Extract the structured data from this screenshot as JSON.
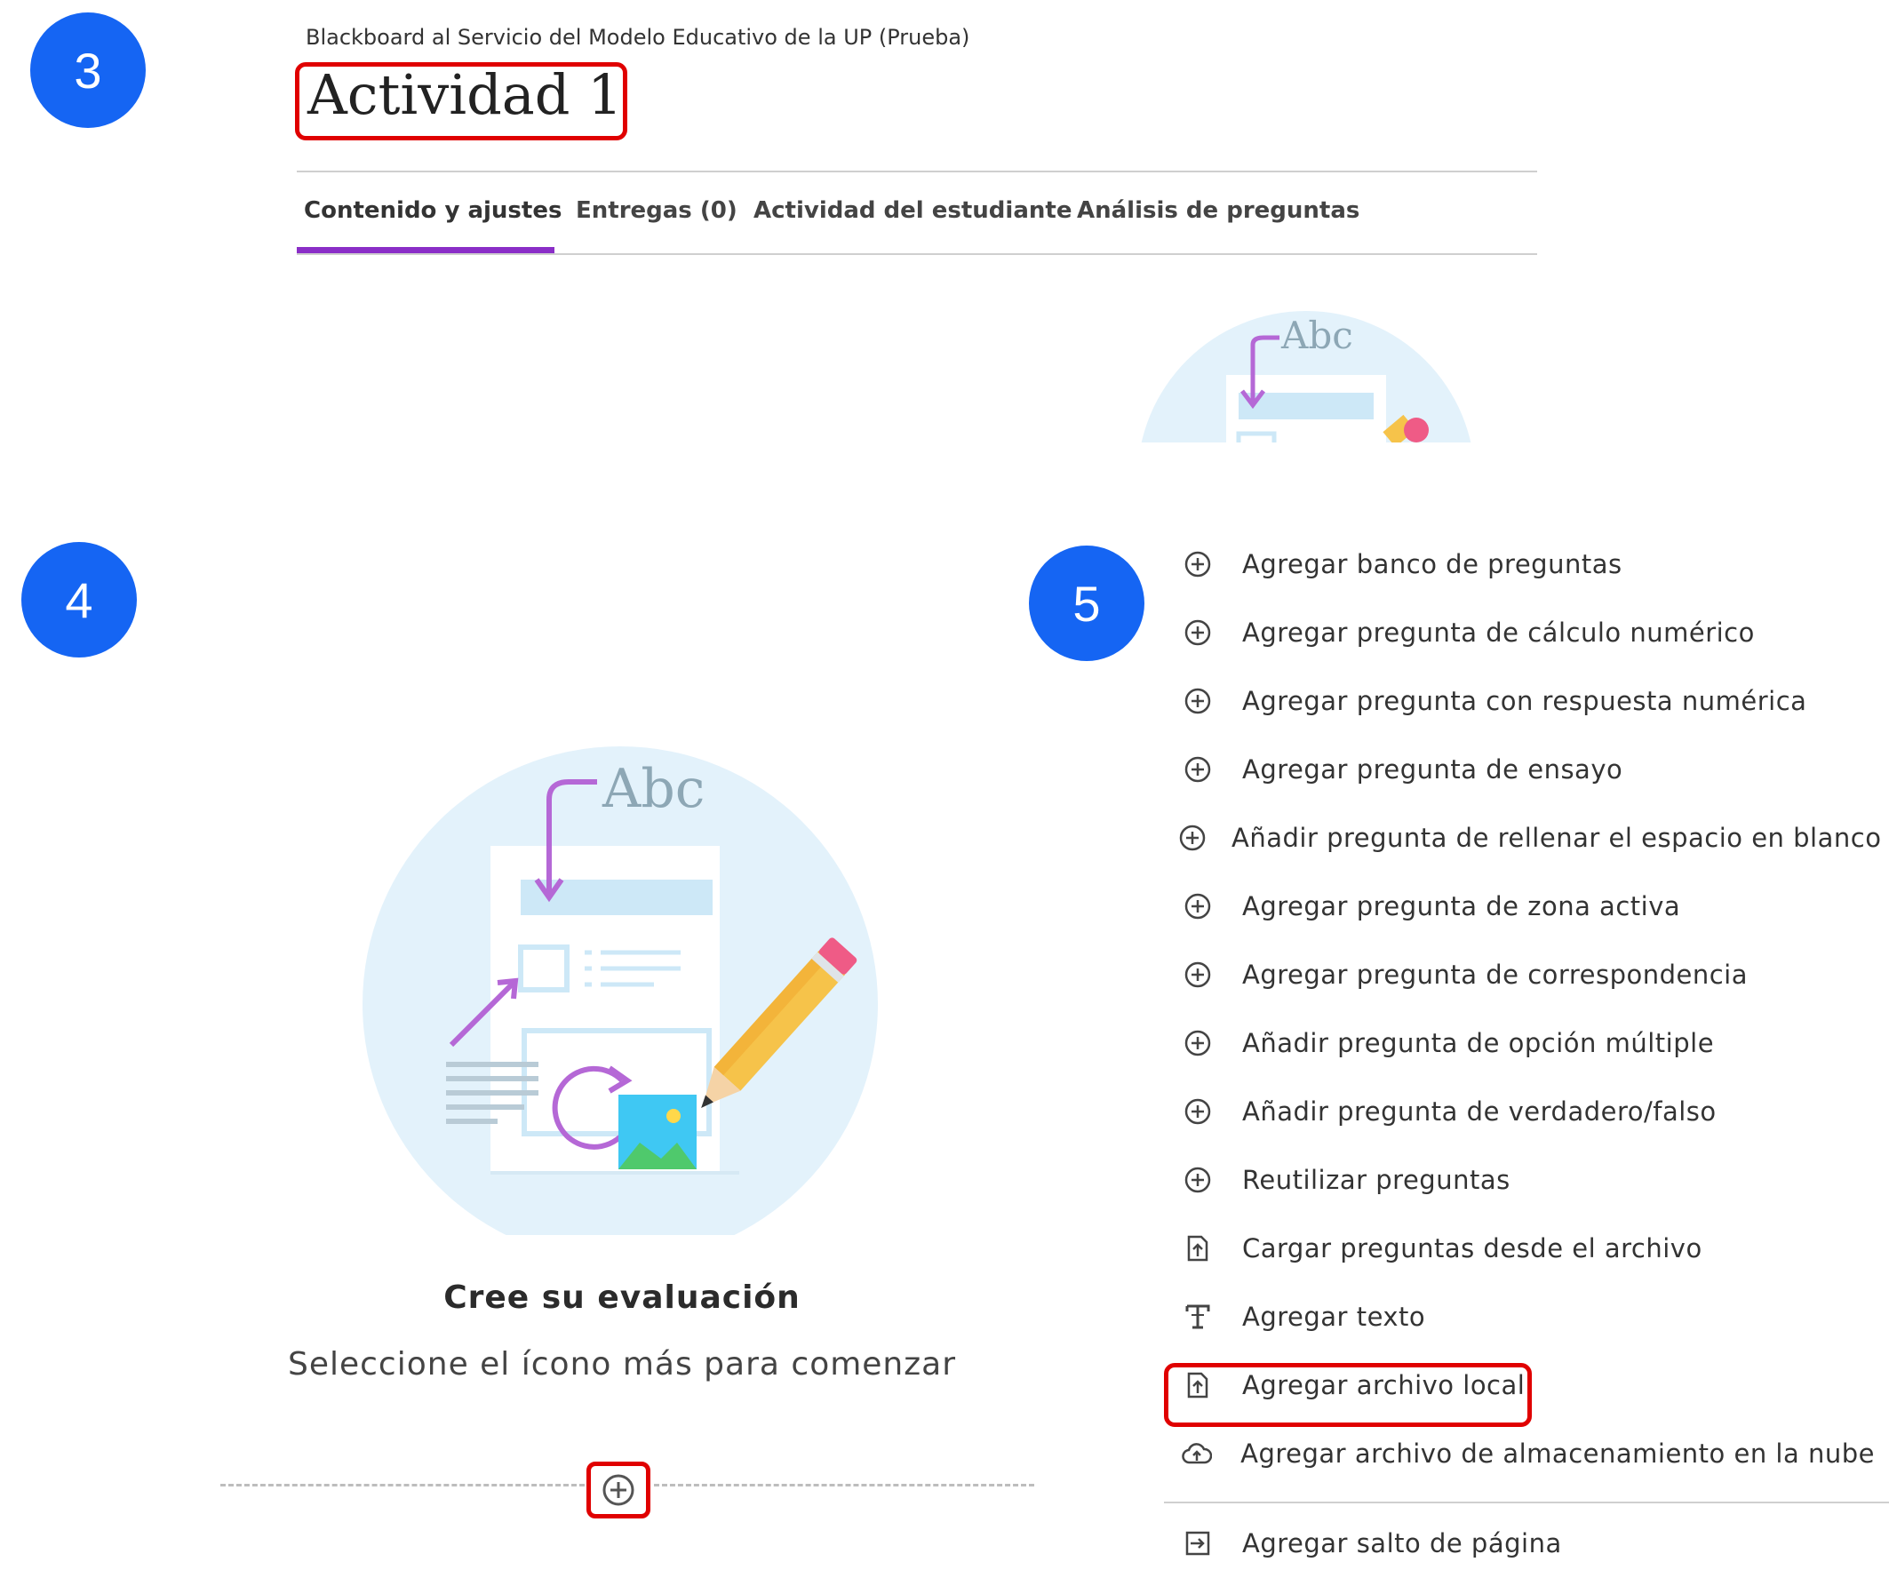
{
  "steps": {
    "step3": "3",
    "step4": "4",
    "step5": "5"
  },
  "header": {
    "breadcrumb": "Blackboard al Servicio del Modelo Educativo de la UP (Prueba)",
    "title": "Actividad 1"
  },
  "tabs": [
    {
      "label": "Contenido y ajustes",
      "active": true
    },
    {
      "label": "Entregas (0)",
      "active": false
    },
    {
      "label": "Actividad del estudiante",
      "active": false
    },
    {
      "label": "Análisis de preguntas",
      "active": false
    }
  ],
  "illustration": {
    "text": "Abc"
  },
  "empty_state": {
    "title": "Cree su evaluación",
    "subtitle": "Seleccione el ícono más para comenzar"
  },
  "menu": {
    "items": [
      {
        "label": "Agregar banco de preguntas",
        "icon": "plus-circle-icon"
      },
      {
        "label": "Agregar pregunta de cálculo numérico",
        "icon": "plus-circle-icon"
      },
      {
        "label": "Agregar pregunta con respuesta numérica",
        "icon": "plus-circle-icon"
      },
      {
        "label": "Agregar pregunta de ensayo",
        "icon": "plus-circle-icon"
      },
      {
        "label": "Añadir pregunta de rellenar el espacio en blanco",
        "icon": "plus-circle-icon"
      },
      {
        "label": "Agregar pregunta de zona activa",
        "icon": "plus-circle-icon"
      },
      {
        "label": "Agregar pregunta de correspondencia",
        "icon": "plus-circle-icon"
      },
      {
        "label": "Añadir pregunta de opción múltiple",
        "icon": "plus-circle-icon"
      },
      {
        "label": "Añadir pregunta de verdadero/falso",
        "icon": "plus-circle-icon"
      },
      {
        "label": "Reutilizar preguntas",
        "icon": "plus-circle-icon"
      },
      {
        "label": "Cargar preguntas desde el archivo",
        "icon": "file-upload-icon"
      },
      {
        "label": "Agregar texto",
        "icon": "text-icon"
      },
      {
        "label": "Agregar archivo local",
        "icon": "file-upload-icon"
      },
      {
        "label": "Agregar archivo de almacenamiento en la nube",
        "icon": "cloud-upload-icon"
      },
      {
        "label": "Agregar salto de página",
        "icon": "page-break-icon"
      }
    ]
  },
  "colors": {
    "badge": "#1565f3",
    "highlight": "#e00000",
    "tab_active": "#8a2ec7"
  }
}
